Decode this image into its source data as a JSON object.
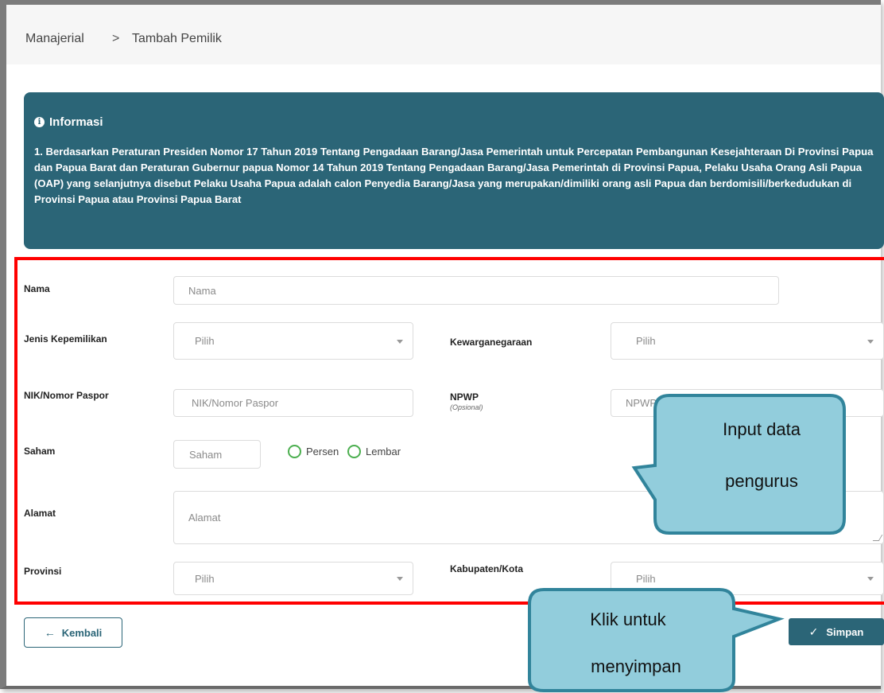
{
  "breadcrumb": {
    "parent": "Manajerial",
    "separator": ">",
    "current": "Tambah Pemilik"
  },
  "info": {
    "icon": "info-circle-icon",
    "title": "Informasi",
    "text": "1. Berdasarkan Peraturan Presiden Nomor 17 Tahun 2019 Tentang Pengadaan Barang/Jasa Pemerintah untuk Percepatan Pembangunan Kesejahteraan Di Provinsi Papua dan Papua Barat dan Peraturan Gubernur papua Nomor 14 Tahun 2019 Tentang Pengadaan Barang/Jasa Pemerintah di Provinsi Papua, Pelaku Usaha Orang Asli Papua (OAP) yang selanjutnya disebut Pelaku Usaha Papua adalah calon Penyedia Barang/Jasa yang merupakan/dimiliki orang asli Papua dan berdomisili/berkedudukan di Provinsi Papua atau Provinsi Papua Barat"
  },
  "form": {
    "nama": {
      "label": "Nama",
      "placeholder": "Nama"
    },
    "jenis_kepemilikan": {
      "label": "Jenis Kepemilikan",
      "value": "Pilih"
    },
    "kewarganegaraan": {
      "label": "Kewarganegaraan",
      "value": "Pilih"
    },
    "nik": {
      "label": "NIK/Nomor Paspor",
      "placeholder": "NIK/Nomor Paspor"
    },
    "npwp": {
      "label": "NPWP",
      "sublabel": "(Opsional)",
      "placeholder": "NPWP"
    },
    "saham": {
      "label": "Saham",
      "placeholder": "Saham",
      "option_persen": "Persen",
      "option_lembar": "Lembar"
    },
    "alamat": {
      "label": "Alamat",
      "placeholder": "Alamat"
    },
    "provinsi": {
      "label": "Provinsi",
      "value": "Pilih"
    },
    "kabupaten": {
      "label": "Kabupaten/Kota",
      "value": "Pilih"
    }
  },
  "buttons": {
    "kembali": "Kembali",
    "simpan": "Simpan"
  },
  "callouts": {
    "input_line1": "Input data",
    "input_line2": "pengurus",
    "klik_line1": "Klik untuk",
    "klik_line2": "menyimpan"
  },
  "colors": {
    "primary": "#2b6577",
    "highlight": "#ff0000",
    "callout_fill": "#92cddc",
    "callout_stroke": "#31849b"
  }
}
